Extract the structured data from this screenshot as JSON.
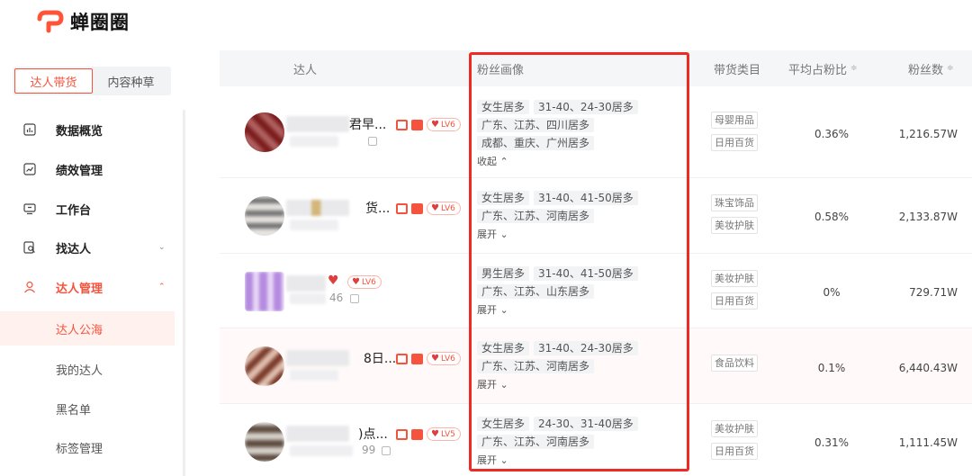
{
  "brand": {
    "name": "蝉圈圈",
    "accent": "#f5533d",
    "logo_color": "#ff5438"
  },
  "sidebar": {
    "tabs": [
      {
        "label": "达人带货",
        "active": true
      },
      {
        "label": "内容种草",
        "active": false
      }
    ],
    "menu": [
      {
        "label": "数据概览",
        "icon": "chart-board-icon"
      },
      {
        "label": "绩效管理",
        "icon": "trend-line-icon"
      },
      {
        "label": "工作台",
        "icon": "monitor-icon"
      },
      {
        "label": "找达人",
        "icon": "search-doc-icon",
        "chevron": "⌄"
      },
      {
        "label": "达人管理",
        "icon": "person-icon",
        "chevron": "⌃",
        "open": true
      }
    ],
    "submenu": [
      {
        "label": "达人公海",
        "active": true
      },
      {
        "label": "我的达人"
      },
      {
        "label": "黑名单"
      },
      {
        "label": "标签管理"
      }
    ]
  },
  "table": {
    "headers": {
      "creator": "达人",
      "portrait": "粉丝画像",
      "category": "带货类目",
      "avg_ratio": "平均占粉比",
      "fans": "粉丝数",
      "sort_icon": "≑"
    },
    "rows": [
      {
        "name_tail": "君早...",
        "level": "LV6",
        "portrait": [
          [
            "女生居多",
            "31-40、24-30居多"
          ],
          [
            "广东、江苏、四川居多"
          ],
          [
            "成都、重庆、广州居多"
          ]
        ],
        "toggle": "收起 ⌃",
        "categories": [
          "母婴用品",
          "日用百货"
        ],
        "avg_ratio": "0.36%",
        "fans": "1,216.57W"
      },
      {
        "name_tail": "货...",
        "level": "LV6",
        "portrait": [
          [
            "女生居多",
            "31-40、41-50居多"
          ],
          [
            "广东、江苏、河南居多"
          ]
        ],
        "toggle": "展开 ⌄",
        "categories": [
          "珠宝饰品",
          "美妆护肤"
        ],
        "avg_ratio": "0.58%",
        "fans": "2,133.87W"
      },
      {
        "id_tail": "46",
        "level": "LV6",
        "portrait": [
          [
            "男生居多",
            "31-40、41-50居多"
          ],
          [
            "广东、江苏、山东居多"
          ]
        ],
        "toggle": "展开 ⌄",
        "categories": [
          "美妆护肤",
          "日用百货"
        ],
        "avg_ratio": "0%",
        "fans": "729.71W"
      },
      {
        "name_tail": "8日...",
        "level": "LV6",
        "portrait": [
          [
            "女生居多",
            "31-40、24-30居多"
          ],
          [
            "广东、江苏、河南居多"
          ]
        ],
        "toggle": "展开 ⌄",
        "categories": [
          "食品饮料"
        ],
        "avg_ratio": "0.1%",
        "fans": "6,440.43W"
      },
      {
        "name_tail": ")点...",
        "id_tail": "99",
        "level": "LV5",
        "portrait": [
          [
            "女生居多",
            "24-30、31-40居多"
          ],
          [
            "广东、江苏、河南居多"
          ]
        ],
        "toggle": "展开 ⌄",
        "categories": [
          "美妆护肤",
          "日用百货"
        ],
        "avg_ratio": "0.31%",
        "fans": "1,111.45W"
      }
    ]
  },
  "highlight": {
    "target": "粉丝画像 column",
    "color": "#ee2a24"
  }
}
